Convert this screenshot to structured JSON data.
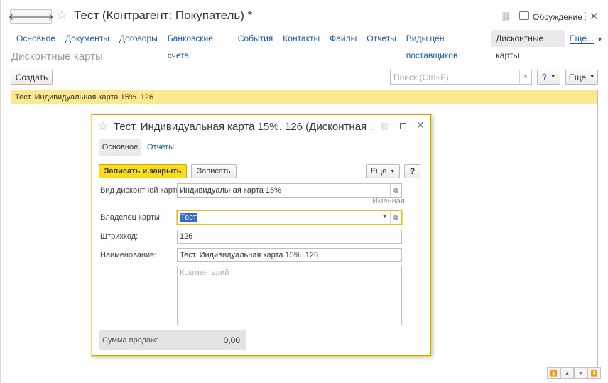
{
  "window": {
    "title": "Тест (Контрагент: Покупатель) *",
    "discuss_label": "Обсуждение",
    "more_dots": "⋮",
    "close": "✕",
    "back": "🡐",
    "forward": "🡒",
    "star": "☆",
    "link": "⛓"
  },
  "tabs": [
    {
      "label": "Основное"
    },
    {
      "label": "Документы"
    },
    {
      "label": "Договоры"
    },
    {
      "label": "Банковские счета"
    },
    {
      "label": "События"
    },
    {
      "label": "Контакты"
    },
    {
      "label": "Файлы"
    },
    {
      "label": "Отчеты"
    },
    {
      "label": "Виды цен поставщиков"
    },
    {
      "label": "Дисконтные карты",
      "active": true
    },
    {
      "label": "Еще..."
    }
  ],
  "section_title": "Дисконтные карты",
  "toolbar": {
    "create_label": "Создать",
    "search_placeholder": "Поиск (Ctrl+F)",
    "search_clear": "×",
    "search_icon": "🔍",
    "more_label": "Еще"
  },
  "list": {
    "rows": [
      {
        "text": "Тест. Индивидуальная карта 15%. 126",
        "selected": true
      }
    ]
  },
  "modal": {
    "title": "Тест. Индивидуальная карта 15%. 126 (Дисконтная ...",
    "tab_main": "Основное",
    "tab_reports": "Отчеты",
    "save_close_label": "Записать и закрыть",
    "save_label": "Записать",
    "more_label": "Еще",
    "help_label": "?",
    "fields": {
      "card_type_label": "Вид дисконтной карты:",
      "card_type_value": "Индивидуальная карта 15%",
      "card_type_hint": "Именная",
      "owner_label": "Владелец карты:",
      "owner_value": "Тест",
      "barcode_label": "Штрихкод:",
      "barcode_value": "126",
      "name_label": "Наименование:",
      "name_value": "Тест. Индивидуальная карта 15%. 126",
      "comment_placeholder": "Комментарий"
    },
    "sales_label": "Сумма продаж:",
    "sales_value": "0,00"
  },
  "colors": {
    "accent_yellow": "#fbdc1b",
    "selected_row": "#fbe88f",
    "link_blue": "#1c59a5"
  }
}
